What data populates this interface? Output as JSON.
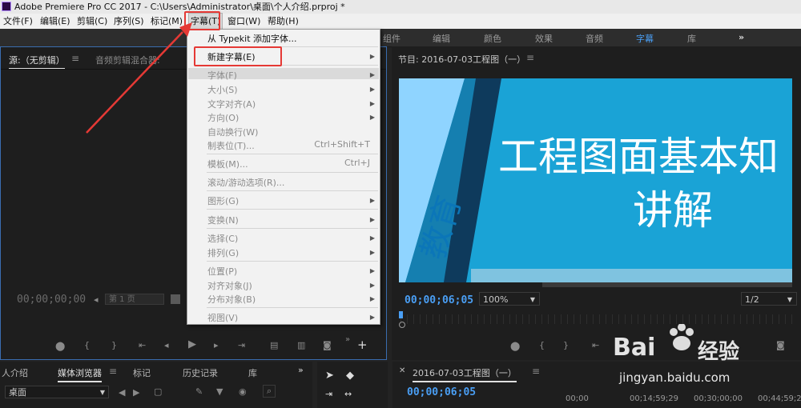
{
  "window": {
    "title": "Adobe Premiere Pro CC 2017 - C:\\Users\\Administrator\\桌面\\个人介绍.prproj *"
  },
  "menubar": {
    "file": "文件(F)",
    "edit": "编辑(E)",
    "clip": "剪辑(C)",
    "sequence": "序列(S)",
    "marker": "标记(M)",
    "title": "字幕(T)",
    "window": "窗口(W)",
    "help": "帮助(H)"
  },
  "workspaces": {
    "assembly": "组件",
    "editing": "编辑",
    "color": "颜色",
    "effects": "效果",
    "audio": "音频",
    "titles": "字幕",
    "libraries": "库",
    "more": "»"
  },
  "source_panel": {
    "tab_source": "源:（无剪辑）",
    "tab_audio_mixer": "音频剪辑混合器:",
    "timecode": "00;00;00;00",
    "page_label": "第 1 页"
  },
  "program_panel": {
    "tab": "节目: 2016-07-03工程图（一）",
    "timecode": "00;00;06;05",
    "zoom": "100%",
    "resolution": "1/2",
    "slide_title_line1": "工程图面基本知",
    "slide_title_line2": "讲解",
    "slide_vertical_text": "教育"
  },
  "project_panel": {
    "tab_intro": "人介绍",
    "tab_media_browser": "媒体浏览器",
    "tab_markers": "标记",
    "tab_history": "历史记录",
    "tab_libraries": "库",
    "location": "桌面"
  },
  "timeline_panel": {
    "tab": "2016-07-03工程图（一）",
    "timecode": "00;00;06;05",
    "ruler": [
      "00;00",
      "00;14;59;29",
      "00;30;00;00",
      "00;44;59;29"
    ]
  },
  "title_menu": {
    "items": [
      {
        "label": "从 Typekit 添加字体...",
        "enabled": true
      },
      {
        "label": "新建字幕(E)",
        "enabled": true,
        "submenu": true
      },
      {
        "label": "字体(F)",
        "enabled": false,
        "submenu": true
      },
      {
        "label": "大小(S)",
        "enabled": false,
        "submenu": true
      },
      {
        "label": "文字对齐(A)",
        "enabled": false,
        "submenu": true
      },
      {
        "label": "方向(O)",
        "enabled": false,
        "submenu": true
      },
      {
        "label": "自动换行(W)",
        "enabled": false
      },
      {
        "label": "制表位(T)...",
        "enabled": false,
        "shortcut": "Ctrl+Shift+T"
      },
      {
        "label": "模板(M)...",
        "enabled": false,
        "shortcut": "Ctrl+J"
      },
      {
        "label": "滚动/游动选项(R)...",
        "enabled": false
      },
      {
        "label": "图形(G)",
        "enabled": false,
        "submenu": true
      },
      {
        "label": "变换(N)",
        "enabled": false,
        "submenu": true
      },
      {
        "label": "选择(C)",
        "enabled": false,
        "submenu": true
      },
      {
        "label": "排列(G)",
        "enabled": false,
        "submenu": true
      },
      {
        "label": "位置(P)",
        "enabled": false,
        "submenu": true
      },
      {
        "label": "对齐对象(J)",
        "enabled": false,
        "submenu": true
      },
      {
        "label": "分布对象(B)",
        "enabled": false,
        "submenu": true
      },
      {
        "label": "视图(V)",
        "enabled": false,
        "submenu": true
      }
    ]
  },
  "watermark": {
    "brand_left": "Bai",
    "brand_right": "经验",
    "url": "jingyan.baidu.com"
  },
  "colors": {
    "accent": "#4a9ff5",
    "highlight": "#e53935",
    "slide_bg": "#1aa3d6"
  }
}
